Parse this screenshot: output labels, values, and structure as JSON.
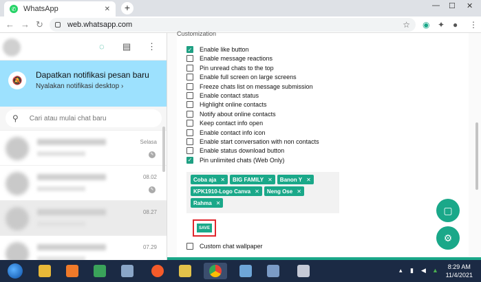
{
  "browser": {
    "tab_title": "WhatsApp",
    "tab_favicon": "whatsapp-icon",
    "url": "web.whatsapp.com",
    "new_tab": "+",
    "win_min": "—",
    "win_max": "☐",
    "win_close": "✕"
  },
  "left": {
    "notification": {
      "title": "Dapatkan notifikasi pesan baru",
      "subtitle": "Nyalakan notifikasi desktop ›"
    },
    "search": {
      "placeholder": "Cari atau mulai chat baru"
    },
    "chats": [
      {
        "time": "Selasa",
        "pinned": true,
        "selected": false
      },
      {
        "time": "08.02",
        "pinned": true,
        "selected": false
      },
      {
        "time": "08.27",
        "pinned": false,
        "selected": true
      },
      {
        "time": "07.29",
        "pinned": false,
        "selected": false
      }
    ]
  },
  "settings": {
    "section_title": "Customization",
    "options": [
      {
        "label": "Enable like button",
        "checked": true
      },
      {
        "label": "Enable message reactions",
        "checked": false
      },
      {
        "label": "Pin unread chats to the top",
        "checked": false
      },
      {
        "label": "Enable full screen on large screens",
        "checked": false
      },
      {
        "label": "Freeze chats list on message submission",
        "checked": false
      },
      {
        "label": "Enable contact status",
        "checked": false
      },
      {
        "label": "Highlight online contacts",
        "checked": false
      },
      {
        "label": "Notify about online contacts",
        "checked": false
      },
      {
        "label": "Keep contact info open",
        "checked": false
      },
      {
        "label": "Enable contact info icon",
        "checked": false
      },
      {
        "label": "Enable start conversation with non contacts",
        "checked": false
      },
      {
        "label": "Enable status download button",
        "checked": false
      },
      {
        "label": "Pin unlimited chats (Web Only)",
        "checked": true
      }
    ],
    "pinned_tags": [
      "Coba aja",
      "BIG FAMILY",
      "Banon Y",
      "KPK1910-Logo Canva",
      "Neng Ose",
      "Rahma"
    ],
    "save_label": "SAVE",
    "wallpaper_label": "Custom chat wallpaper",
    "wallpaper_checked": false
  },
  "taskbar": {
    "time": "8:29 AM",
    "date": "11/4/2021"
  },
  "colors": {
    "accent": "#1aa889",
    "notif_bg": "#9de1fe",
    "highlight_border": "#e0262c",
    "taskbar": "#1b2a44"
  }
}
